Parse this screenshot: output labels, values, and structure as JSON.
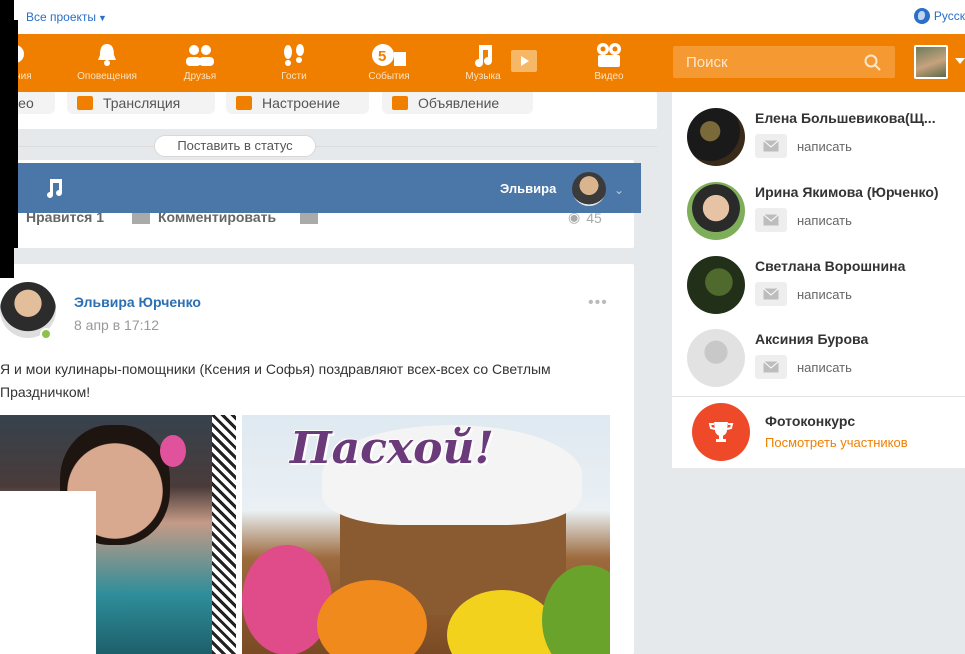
{
  "header": {
    "all_projects": "Все проекты",
    "language": "Русск"
  },
  "toolbar": {
    "accent_color": "#f07f00",
    "items": [
      {
        "label": "едения",
        "icon": "messages-icon"
      },
      {
        "label": "Оповещения",
        "icon": "bell-icon"
      },
      {
        "label": "Друзья",
        "icon": "friends-icon"
      },
      {
        "label": "Гости",
        "icon": "footprints-icon"
      },
      {
        "label": "События",
        "icon": "events-icon"
      },
      {
        "label": "Музыка",
        "icon": "music-note-icon"
      },
      {
        "label": "Видео",
        "icon": "video-icon"
      }
    ],
    "search_placeholder": "Поиск"
  },
  "quick_actions": [
    {
      "label": "део",
      "icon": "video-icon"
    },
    {
      "label": "Трансляция",
      "icon": "broadcast-icon"
    },
    {
      "label": "Настроение",
      "icon": "mood-icon"
    },
    {
      "label": "Объявление",
      "icon": "announcement-icon"
    }
  ],
  "status_button": "Поставить в статус",
  "prev_post": {
    "like_label": "Нравится",
    "like_count": "1",
    "comment_label": "Комментировать",
    "views": "45"
  },
  "player": {
    "user_name": "Эльвира",
    "bar_color": "#4a76a8"
  },
  "post": {
    "author": "Эльвира Юрченко",
    "date": "8 апр в 17:12",
    "text": "Я и мои кулинары-помощники (Ксения и Софья) поздравляют всех-всех со Светлым Праздничком!",
    "image_caption": "Пасхой!"
  },
  "friends": [
    {
      "name": "Елена Большевикова(Щ...",
      "action": "написать"
    },
    {
      "name": "Ирина Якимова (Юрченко)",
      "action": "написать"
    },
    {
      "name": "Светлана Ворошнина",
      "action": "написать"
    },
    {
      "name": "Аксиния Бурова",
      "action": "написать"
    }
  ],
  "contest": {
    "title": "Фотоконкурс",
    "link": "Посмотреть участников",
    "icon": "trophy-icon"
  }
}
